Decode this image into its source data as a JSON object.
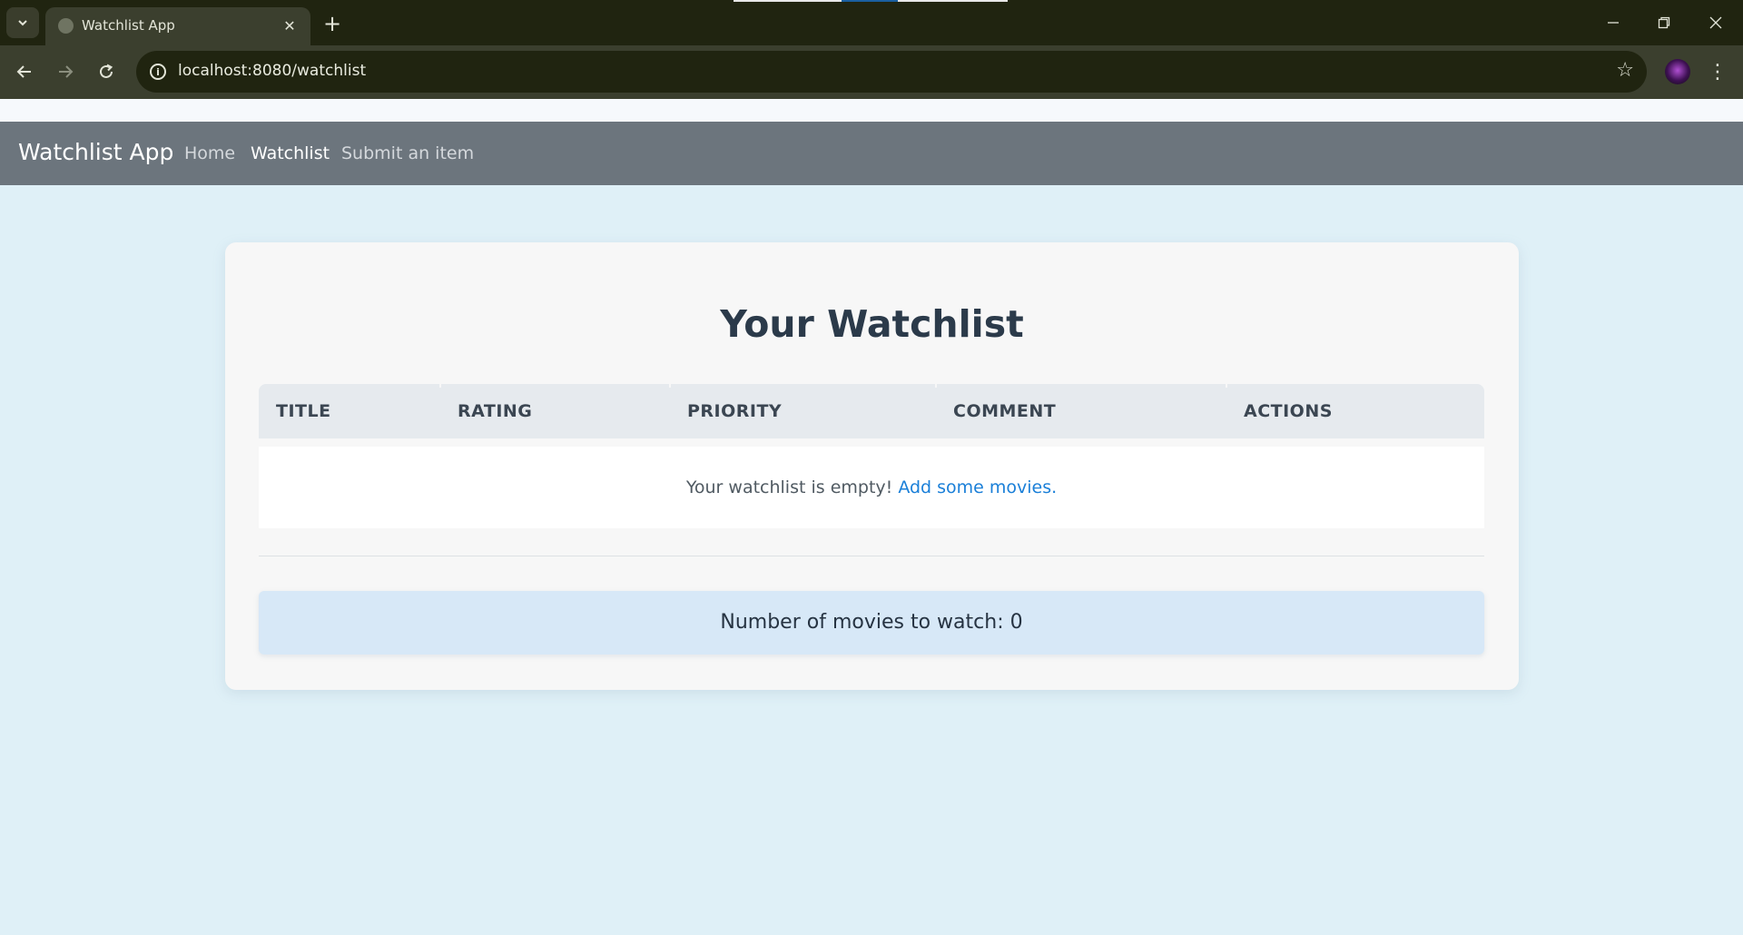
{
  "browser": {
    "tab_title": "Watchlist App",
    "url": "localhost:8080/watchlist",
    "icons": [
      "tab-list-icon",
      "globe-icon",
      "close-icon",
      "plus-icon",
      "minimize-icon",
      "restore-icon",
      "close-window-icon",
      "back-arrow-icon",
      "forward-arrow-icon",
      "reload-icon",
      "site-info-icon",
      "star-icon",
      "profile-avatar",
      "kebab-menu-icon"
    ]
  },
  "navbar": {
    "brand": "Watchlist App",
    "links": [
      {
        "label": "Home",
        "active": false
      },
      {
        "label": "Watchlist",
        "active": true
      },
      {
        "label": "Submit an item",
        "active": false
      }
    ]
  },
  "main": {
    "heading": "Your Watchlist",
    "table": {
      "columns": [
        "TITLE",
        "RATING",
        "PRIORITY",
        "COMMENT",
        "ACTIONS"
      ],
      "empty_message": "Your watchlist is empty!",
      "empty_link": "Add some movies."
    },
    "count_label": "Number of movies to watch: 0"
  },
  "colors": {
    "page_bg": "#dff0f7",
    "navbar_bg": "#6c757d",
    "card_bg": "#f7f7f7",
    "table_head_bg": "#e6eaee",
    "count_box_bg": "#d7e8f7",
    "link": "#1a7fd8",
    "heading": "#2b3a4a"
  }
}
